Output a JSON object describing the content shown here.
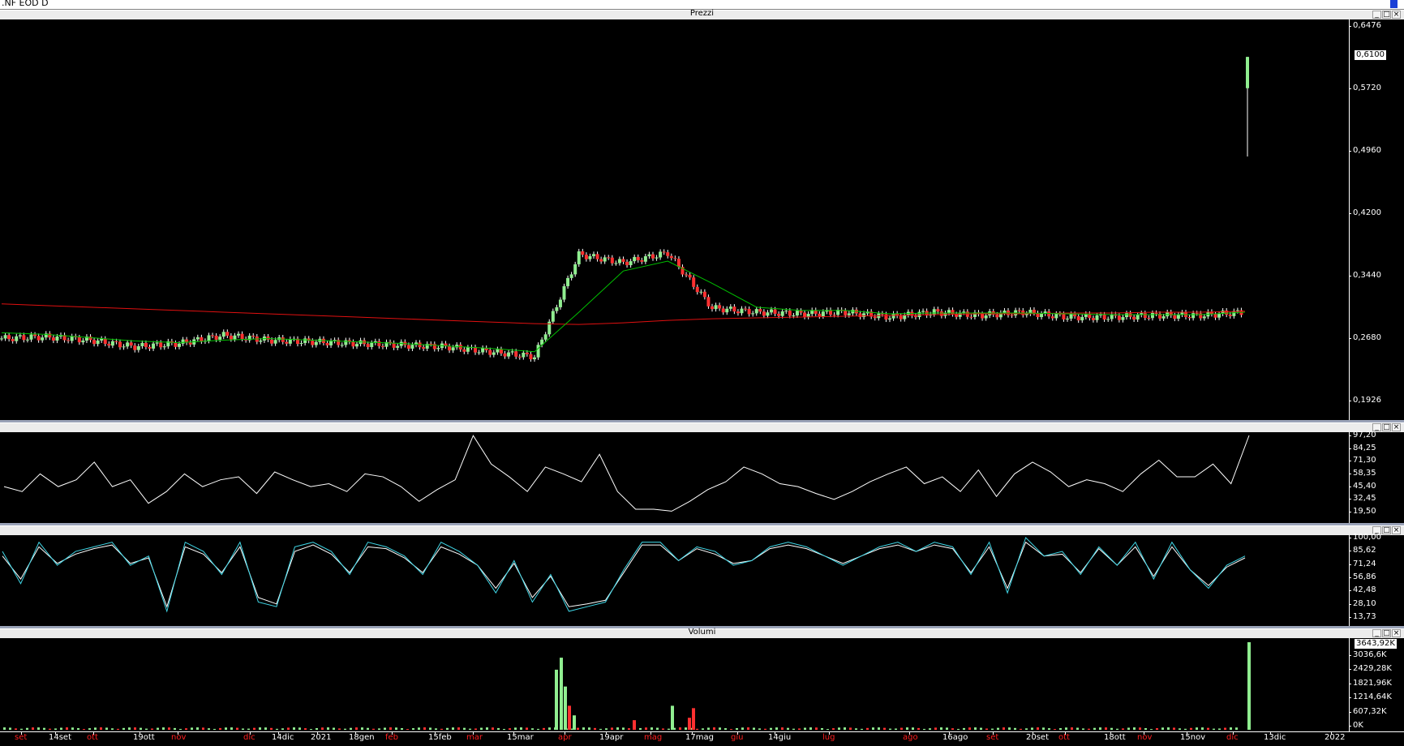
{
  "window": {
    "title": ".NF EOD D"
  },
  "panes": {
    "prices": {
      "title": "Prezzi",
      "y_labels": [
        "0,6476",
        "0,5720",
        "0,4960",
        "0,4200",
        "0,3440",
        "0,2680",
        "0,1926"
      ],
      "last_value": "0,6100"
    },
    "osc1": {
      "title": "",
      "y_labels": [
        "97,20",
        "84,25",
        "71,30",
        "58,35",
        "45,40",
        "32,45",
        "19,50"
      ]
    },
    "osc2": {
      "title": "",
      "y_labels": [
        "100,00",
        "85,62",
        "71,24",
        "56,86",
        "42,48",
        "28,10",
        "13,73"
      ]
    },
    "volume": {
      "title": "Volumi",
      "y_labels": [
        "3036,6K",
        "2429,28K",
        "1821,96K",
        "1214,64K",
        "607,32K",
        "0K"
      ],
      "last_value": "3643,92K"
    }
  },
  "pane_buttons": {
    "minimize": "_",
    "restore": "□",
    "close": "×"
  },
  "x_axis": [
    {
      "label": "set",
      "color": "#ff2020"
    },
    {
      "label": "14set",
      "color": "#ffffff"
    },
    {
      "label": "ott",
      "color": "#ff2020"
    },
    {
      "label": "19ott",
      "color": "#ffffff"
    },
    {
      "label": "nov",
      "color": "#ff2020"
    },
    {
      "label": "dic",
      "color": "#ff2020"
    },
    {
      "label": "14dic",
      "color": "#ffffff"
    },
    {
      "label": "2021",
      "color": "#ffffff"
    },
    {
      "label": "18gen",
      "color": "#ffffff"
    },
    {
      "label": "feb",
      "color": "#ff2020"
    },
    {
      "label": "15feb",
      "color": "#ffffff"
    },
    {
      "label": "mar",
      "color": "#ff2020"
    },
    {
      "label": "15mar",
      "color": "#ffffff"
    },
    {
      "label": "apr",
      "color": "#ff2020"
    },
    {
      "label": "19apr",
      "color": "#ffffff"
    },
    {
      "label": "mag",
      "color": "#ff2020"
    },
    {
      "label": "17mag",
      "color": "#ffffff"
    },
    {
      "label": "giu",
      "color": "#ff2020"
    },
    {
      "label": "14giu",
      "color": "#ffffff"
    },
    {
      "label": "lug",
      "color": "#ff2020"
    },
    {
      "label": "ago",
      "color": "#ff2020"
    },
    {
      "label": "16ago",
      "color": "#ffffff"
    },
    {
      "label": "set",
      "color": "#ff2020"
    },
    {
      "label": "20set",
      "color": "#ffffff"
    },
    {
      "label": "ott",
      "color": "#ff2020"
    },
    {
      "label": "18ott",
      "color": "#ffffff"
    },
    {
      "label": "nov",
      "color": "#ff2020"
    },
    {
      "label": "15nov",
      "color": "#ffffff"
    },
    {
      "label": "dic",
      "color": "#ff2020"
    },
    {
      "label": "13dic",
      "color": "#ffffff"
    },
    {
      "label": "2022",
      "color": "#ffffff"
    }
  ],
  "colors": {
    "up_candle": "#90ee90",
    "down_candle": "#ff3030",
    "ma_short": "#00c000",
    "ma_long": "#e01010",
    "osc_line": "#ffffff",
    "stoch_k": "#40d8e8",
    "stoch_d": "#ffffff",
    "vol_up": "#90ee90",
    "vol_down": "#ff3030"
  },
  "chart_data": [
    {
      "type": "candlestick",
      "title": "Prezzi",
      "ylim": [
        0.1926,
        0.6476
      ],
      "x": [
        "set",
        "14set",
        "ott",
        "19ott",
        "nov",
        "dic",
        "14dic",
        "2021",
        "18gen",
        "feb",
        "15feb",
        "mar",
        "15mar",
        "apr",
        "19apr",
        "mag",
        "17mag",
        "giu",
        "14giu",
        "lug",
        "ago",
        "16ago",
        "set",
        "20set",
        "ott",
        "18ott",
        "nov",
        "15nov",
        "dic"
      ],
      "close": [
        0.268,
        0.27,
        0.266,
        0.258,
        0.262,
        0.272,
        0.266,
        0.264,
        0.262,
        0.26,
        0.258,
        0.252,
        0.246,
        0.37,
        0.36,
        0.372,
        0.305,
        0.3,
        0.298,
        0.3,
        0.294,
        0.3,
        0.296,
        0.3,
        0.294,
        0.294,
        0.296,
        0.296,
        0.3
      ],
      "last_candle": {
        "open": 0.572,
        "high": 0.61,
        "low": 0.489,
        "close": 0.61
      },
      "series": [
        {
          "name": "",
          "role": "short moving average",
          "values": [
            0.275,
            0.273,
            0.269,
            0.265,
            0.263,
            0.266,
            0.268,
            0.266,
            0.264,
            0.262,
            0.259,
            0.256,
            0.252,
            0.3,
            0.35,
            0.362,
            0.335,
            0.306,
            0.302,
            0.302,
            0.298,
            0.299,
            0.299,
            0.299,
            0.298,
            0.297,
            0.297,
            0.297,
            0.3
          ]
        },
        {
          "name": "",
          "role": "long moving average",
          "values": [
            0.31,
            0.308,
            0.306,
            0.304,
            0.302,
            0.3,
            0.298,
            0.296,
            0.294,
            0.292,
            0.29,
            0.288,
            0.286,
            0.285,
            0.287,
            0.29,
            0.292,
            0.293,
            0.294,
            0.295,
            0.296,
            0.297,
            0.298,
            0.298,
            0.299,
            0.299,
            0.3,
            0.3,
            0.301
          ]
        }
      ]
    },
    {
      "type": "line",
      "ylim": [
        19.5,
        97.2
      ],
      "series": [
        {
          "name": "",
          "values": [
            45,
            40,
            58,
            45,
            52,
            70,
            45,
            52,
            28,
            40,
            58,
            45,
            52,
            55,
            38,
            60,
            52,
            45,
            48,
            40,
            58,
            55,
            45,
            30,
            42,
            52,
            97,
            68,
            55,
            40,
            65,
            58,
            50,
            78,
            40,
            22,
            22,
            20,
            30,
            42,
            50,
            65,
            58,
            48,
            45,
            38,
            32,
            40,
            50,
            58,
            65,
            48,
            55,
            40,
            62,
            35,
            58,
            70,
            60,
            45,
            52,
            48,
            40,
            58,
            72,
            55,
            55,
            68,
            48,
            98
          ]
        }
      ]
    },
    {
      "type": "line",
      "ylim": [
        13.73,
        100
      ],
      "series": [
        {
          "name": "",
          "values": [
            85,
            50,
            95,
            70,
            85,
            90,
            95,
            70,
            80,
            20,
            95,
            85,
            60,
            95,
            30,
            25,
            90,
            95,
            85,
            60,
            95,
            90,
            80,
            60,
            95,
            85,
            70,
            40,
            75,
            30,
            60,
            20,
            25,
            30,
            65,
            95,
            95,
            75,
            90,
            85,
            70,
            75,
            90,
            95,
            90,
            80,
            70,
            80,
            90,
            95,
            85,
            95,
            90,
            60,
            95,
            40,
            100,
            80,
            85,
            60,
            90,
            70,
            95,
            55,
            95,
            65,
            45,
            70,
            80
          ]
        },
        {
          "name": "",
          "values": [
            80,
            55,
            90,
            72,
            82,
            88,
            92,
            72,
            78,
            25,
            90,
            82,
            62,
            90,
            35,
            28,
            85,
            92,
            82,
            62,
            90,
            88,
            78,
            62,
            90,
            82,
            70,
            45,
            72,
            35,
            58,
            25,
            28,
            32,
            62,
            92,
            92,
            75,
            88,
            82,
            72,
            75,
            88,
            92,
            88,
            80,
            72,
            80,
            88,
            92,
            85,
            92,
            88,
            62,
            90,
            45,
            95,
            80,
            82,
            62,
            88,
            70,
            90,
            58,
            90,
            65,
            48,
            68,
            78
          ]
        }
      ]
    },
    {
      "type": "bar",
      "title": "Volumi",
      "ylim": [
        0,
        3643.92
      ],
      "x": [
        "apr",
        "apr",
        "apr",
        "apr",
        "apr",
        "mag",
        "mag",
        "mag",
        "mag",
        "dic"
      ],
      "values": [
        2500,
        3000,
        1800,
        1000,
        600,
        400,
        1000,
        500,
        900,
        3643.92
      ]
    }
  ]
}
